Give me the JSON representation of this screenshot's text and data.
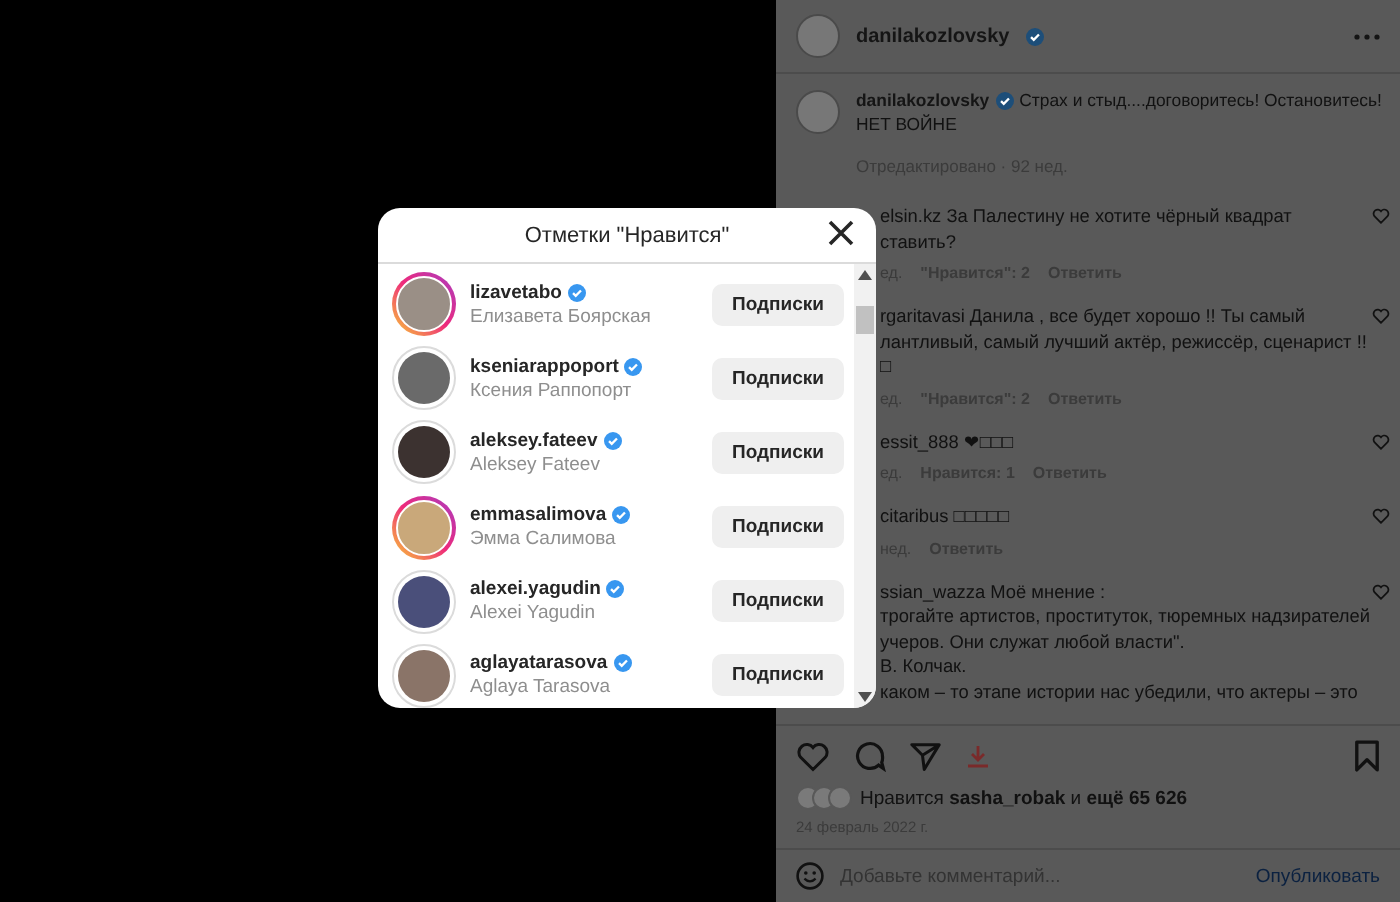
{
  "post": {
    "author": {
      "username": "danilakozlovsky",
      "verified": true
    },
    "caption": {
      "username": "danilakozlovsky",
      "verified": true,
      "text": "Страх и стыд....договоритесь! Остановитесь!",
      "text_line_2": "НЕТ ВОЙНЕ",
      "meta": "Отредактировано · 92 нед."
    },
    "comments": [
      {
        "lines": [
          "elsin.kz За Палестину не хотите чёрный квадрат",
          "ставить?"
        ],
        "meta": [
          {
            "kind": "time",
            "text": "ед."
          },
          {
            "kind": "likes",
            "text": "\"Нравится\": 2"
          },
          {
            "kind": "reply",
            "text": "Ответить"
          }
        ]
      },
      {
        "lines": [
          "rgaritavasi Данила , все будет хорошо !! Ты самый",
          "лантливый, самый лучший актёр, режиссёр, сценарист !!",
          "□"
        ],
        "meta": [
          {
            "kind": "time",
            "text": "ед."
          },
          {
            "kind": "likes",
            "text": "\"Нравится\": 2"
          },
          {
            "kind": "reply",
            "text": "Ответить"
          }
        ]
      },
      {
        "lines": [
          "essit_888 ❤□□□"
        ],
        "meta": [
          {
            "kind": "time",
            "text": "ед."
          },
          {
            "kind": "likes",
            "text": "Нравится: 1"
          },
          {
            "kind": "reply",
            "text": "Ответить"
          }
        ]
      },
      {
        "lines": [
          "citaribus □□□□□"
        ],
        "meta": [
          {
            "kind": "time",
            "text": "нед."
          },
          {
            "kind": "reply",
            "text": "Ответить"
          }
        ]
      },
      {
        "lines": [
          "ssian_wazza Моё мнение :",
          "трогайте артистов, проституток, тюремных надзирателей",
          "учеров. Они служат любой власти\".",
          "В. Колчак.",
          "каком – то этапе истории нас убедили, что актеры – это"
        ]
      }
    ],
    "liked_by": "Нравится **sasha_robak** и **ещё 65 626**",
    "date": "24 февраль 2022 г.",
    "comment_box": {
      "placeholder": "Добавьте комментарий...",
      "post_button": "Опубликовать"
    }
  },
  "likes_modal": {
    "title": "Отметки \"Нравится\"",
    "users": [
      {
        "username": "lizavetabo",
        "name": "Елизавета Боярская",
        "verified": true,
        "story_ring": true,
        "button": "Подписки"
      },
      {
        "username": "kseniarappoport",
        "name": "Ксения Раппопорт",
        "verified": true,
        "story_ring": false,
        "button": "Подписки"
      },
      {
        "username": "aleksey.fateev",
        "name": "Aleksey Fateev",
        "verified": true,
        "story_ring": false,
        "button": "Подписки"
      },
      {
        "username": "emmasalimova",
        "name": "Эмма Салимова",
        "verified": true,
        "story_ring": true,
        "button": "Подписки"
      },
      {
        "username": "alexei.yagudin",
        "name": "Alexei Yagudin",
        "verified": true,
        "story_ring": false,
        "button": "Подписки"
      },
      {
        "username": "aglayatarasova",
        "name": "Aglaya Tarasova",
        "verified": true,
        "story_ring": false,
        "button": "Подписки"
      }
    ]
  }
}
